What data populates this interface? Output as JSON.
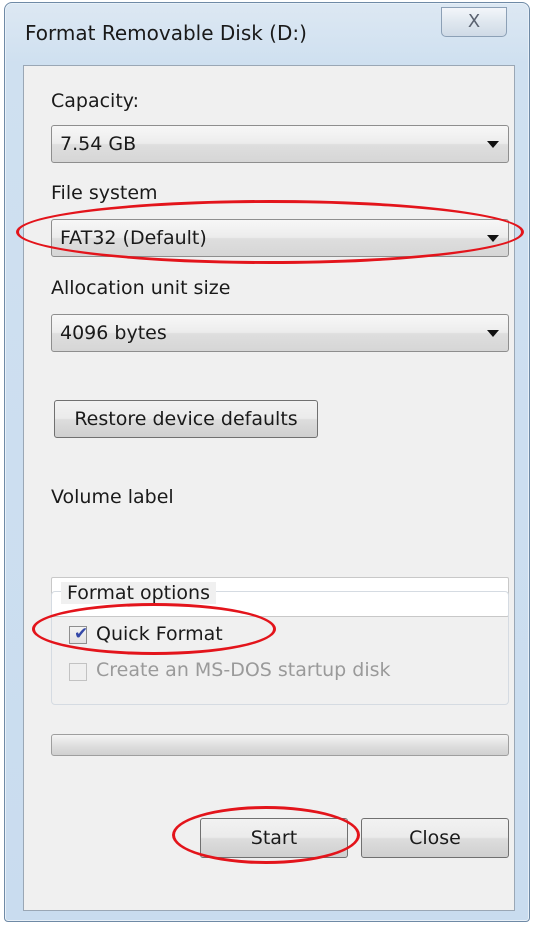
{
  "window": {
    "title": "Format Removable Disk (D:)",
    "close_glyph": "X"
  },
  "capacity": {
    "label": "Capacity:",
    "value": "7.54 GB"
  },
  "file_system": {
    "label": "File system",
    "value": "FAT32 (Default)"
  },
  "allocation": {
    "label": "Allocation unit size",
    "value": "4096 bytes"
  },
  "restore_button": "Restore device defaults",
  "volume_label": {
    "label": "Volume label",
    "value": ""
  },
  "format_options": {
    "title": "Format options",
    "quick_format": {
      "label": "Quick Format",
      "checked": true
    },
    "msdos": {
      "label": "Create an MS-DOS startup disk",
      "checked": false,
      "enabled": false
    }
  },
  "progress": {
    "percent": 0
  },
  "buttons": {
    "start": "Start",
    "close": "Close"
  },
  "colors": {
    "annotation": "#e3141b",
    "check": "#3448a8"
  }
}
